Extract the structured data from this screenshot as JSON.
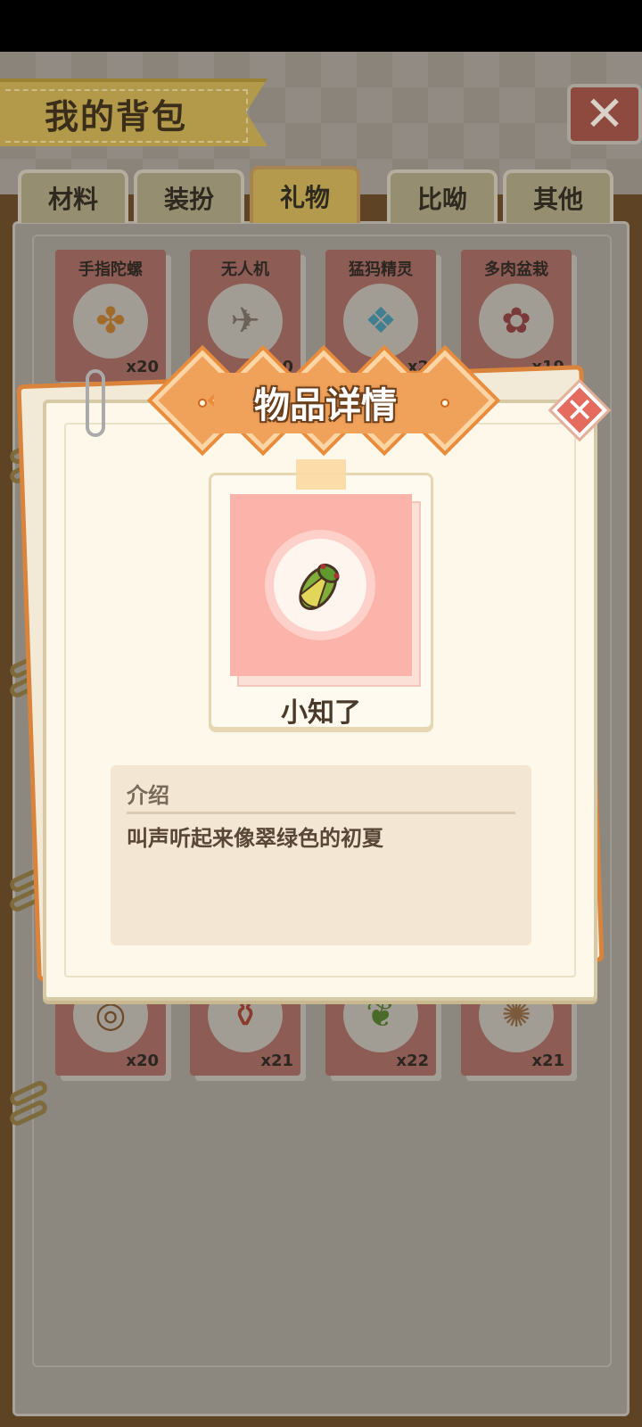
{
  "screen_title": "我的背包",
  "tabs": [
    {
      "label": "材料"
    },
    {
      "label": "装扮"
    },
    {
      "label": "礼物"
    },
    {
      "label": "比呦"
    },
    {
      "label": "其他"
    }
  ],
  "active_tab": "礼物",
  "grid_items": [
    {
      "name": "手指陀螺",
      "count": "x20",
      "icon": "fidget-spinner-icon",
      "glyph": "✤"
    },
    {
      "name": "无人机",
      "count": "x20",
      "icon": "drone-icon",
      "glyph": "✈"
    },
    {
      "name": "猛犸精灵",
      "count": "x2",
      "icon": "mammoth-icon",
      "glyph": "❖"
    },
    {
      "name": "多肉盆栽",
      "count": "x19",
      "icon": "succulent-icon",
      "glyph": "✿"
    },
    {
      "name": "",
      "count": "x20",
      "icon": "whip-icon",
      "glyph": "◎"
    },
    {
      "name": "",
      "count": "x21",
      "icon": "bottle-icon",
      "glyph": "⚱"
    },
    {
      "name": "",
      "count": "x22",
      "icon": "cicada-icon",
      "glyph": "❦"
    },
    {
      "name": "",
      "count": "x21",
      "icon": "shell-icon",
      "glyph": "✺"
    }
  ],
  "modal": {
    "title": "物品详情",
    "item_name": "小知了",
    "item_icon": "cicada-icon",
    "description_label": "介绍",
    "description": "叫声听起来像翠绿色的初夏"
  }
}
